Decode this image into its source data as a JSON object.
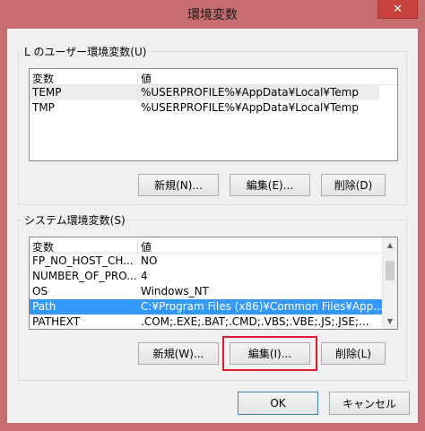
{
  "window": {
    "title": "環境変数",
    "close_glyph": "✕"
  },
  "user_vars": {
    "group_label": "L のユーザー環境変数(U)",
    "columns": [
      "変数",
      "値"
    ],
    "rows": [
      {
        "name": "TEMP",
        "value": "%USERPROFILE%¥AppData¥Local¥Temp"
      },
      {
        "name": "TMP",
        "value": "%USERPROFILE%¥AppData¥Local¥Temp"
      }
    ],
    "buttons": {
      "new": "新規(N)...",
      "edit": "編集(E)...",
      "delete": "削除(D)"
    }
  },
  "system_vars": {
    "group_label": "システム環境変数(S)",
    "columns": [
      "変数",
      "値"
    ],
    "rows": [
      {
        "name": "FP_NO_HOST_CH...",
        "value": "NO"
      },
      {
        "name": "NUMBER_OF_PRO...",
        "value": "4"
      },
      {
        "name": "OS",
        "value": "Windows_NT"
      },
      {
        "name": "Path",
        "value": "C:¥Program Files (x86)¥Common Files¥App..."
      },
      {
        "name": "PATHEXT",
        "value": ".COM;.EXE;.BAT;.CMD;.VBS;.VBE;.JS;.JSE;..."
      }
    ],
    "selected_row": 3,
    "buttons": {
      "new": "新規(W)...",
      "edit": "編集(I)...",
      "delete": "削除(L)"
    },
    "scroll": {
      "up_glyph": "▲",
      "down_glyph": "▼"
    }
  },
  "footer": {
    "ok": "OK",
    "cancel": "キャンセル"
  },
  "colors": {
    "titlebar": "#c66d70",
    "close": "#c7413c",
    "selection": "#3399ff",
    "highlight_box": "#e0182a"
  }
}
